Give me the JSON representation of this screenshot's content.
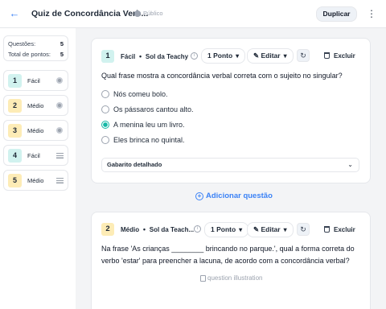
{
  "header": {
    "back_icon": "arrow-left-icon",
    "title": "Quiz de Concordância Verb...",
    "visibility_icon": "globe-icon",
    "visibility": "Público",
    "duplicate_label": "Duplicar",
    "more_icon": "kebab-menu-icon"
  },
  "summary": {
    "questions_label": "Questões:",
    "questions_count": "5",
    "points_label": "Total de pontos:",
    "points_total": "5"
  },
  "sidebar": {
    "items": [
      {
        "number": "1",
        "difficulty": "Fácil",
        "type_icon": "radio-icon"
      },
      {
        "number": "2",
        "difficulty": "Médio",
        "type_icon": "radio-icon"
      },
      {
        "number": "3",
        "difficulty": "Médio",
        "type_icon": "radio-icon"
      },
      {
        "number": "4",
        "difficulty": "Fácil",
        "type_icon": "lines-icon"
      },
      {
        "number": "5",
        "difficulty": "Médio",
        "type_icon": "lines-icon"
      }
    ]
  },
  "questions": [
    {
      "number": "1",
      "difficulty": "Fácil",
      "source": "Sol da Teachy",
      "points": "1 Ponto",
      "edit_label": "Editar",
      "delete_label": "Excluir",
      "text": "Qual frase mostra a concordância verbal correta com o sujeito no singular?",
      "options": [
        {
          "text": "Nós comeu bolo.",
          "selected": false
        },
        {
          "text": "Os pássaros cantou alto.",
          "selected": false
        },
        {
          "text": "A menina leu um livro.",
          "selected": true
        },
        {
          "text": "Eles brinca no quintal.",
          "selected": false
        }
      ],
      "answer_key_label": "Gabarito detalhado"
    },
    {
      "number": "2",
      "difficulty": "Médio",
      "source": "Sol da Teach...",
      "points": "1 Ponto",
      "edit_label": "Editar",
      "delete_label": "Excluir",
      "text_line1": "Na frase 'As crianças ________ brincando no parque.', qual a forma correta do",
      "text_line2": "verbo 'estar' para preencher a lacuna, de acordo com a concordância verbal?",
      "image_alt": "question illustration"
    }
  ],
  "add_question_label": "Adicionar questão",
  "colors": {
    "accent_blue": "#3b82f6",
    "easy_badge": "#d1f2ef",
    "medium_badge": "#fdecb6",
    "selected_radio": "#14b8a6"
  }
}
